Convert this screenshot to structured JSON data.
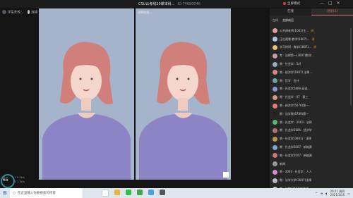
{
  "window": {
    "title": "CSU公考线20课本科...",
    "room_id": "ID:74690046",
    "mode_label": "全屏模式",
    "controls": [
      "—",
      "□",
      "✕"
    ]
  },
  "top_left": {
    "item1": "学生在校...",
    "item2": "连接"
  },
  "videos": [
    {
      "label": ""
    },
    {
      "label": "讲师在线..."
    }
  ],
  "status": {
    "speed_value": "65",
    "upload": "↑ 0.2k/s",
    "download": "↓ 1.3k/s"
  },
  "panel": {
    "tabs": [
      "在线",
      "讨论(1)"
    ],
    "sub_tabs": [
      "在线",
      "全部成员"
    ],
    "members": [
      {
        "name": "公共课老师(1001)主...",
        "color": "#d9a0a0",
        "tag": "讲"
      },
      {
        "name": "正在观看-数学(1807)...",
        "color": "#b0c4de",
        "tag": "讲"
      },
      {
        "name": "学习时间 · 数学(1807)...",
        "color": "#e6c27a",
        "tag": "讲"
      },
      {
        "name": "考 · 法律第一(3007)数学...",
        "color": "#c9a",
        "tag": ""
      },
      {
        "name": "期 · 社会学 · 5/4",
        "color": "#9ab",
        "tag": ""
      },
      {
        "name": "期 · 经济学(1807) 法律...",
        "color": "#d88",
        "tag": ""
      },
      {
        "name": "期 · 哲学 · 会计",
        "color": "#6a9",
        "tag": ""
      },
      {
        "name": "期 · 社会学2806 英语...",
        "color": "#89c",
        "tag": ""
      },
      {
        "name": "期 · 社会学 · 07 · 第三",
        "color": "#c98",
        "tag": ""
      },
      {
        "name": "期 · 经济学(5076)第一 ·",
        "color": "#e77",
        "tag": ""
      },
      {
        "name": "期 · 法学院(6789)第一",
        "color": "#222",
        "tag": ""
      },
      {
        "name": "期 · 社会学 · 2003 · 法律",
        "color": "#5b7",
        "tag": ""
      },
      {
        "name": "期 · 社会学2806 · 经济学",
        "color": "#a77",
        "tag": ""
      },
      {
        "name": "期 · 社会学(3001) · 法律",
        "color": "#b95",
        "tag": ""
      },
      {
        "name": "期 · 社会学2007 · 新能源",
        "color": "#7ac",
        "tag": ""
      },
      {
        "name": "期 · 社会学2007 · 新能源",
        "color": "#c77",
        "tag": ""
      },
      {
        "name": "新闻",
        "color": "#999",
        "tag": ""
      },
      {
        "name": "期 · 2003 · 社会学 · 人人",
        "color": "#d8c",
        "tag": ""
      },
      {
        "name": "期 · 法学大学(3007)法律",
        "color": "#bbb",
        "tag": ""
      },
      {
        "name": "期 · 法院(3007)新能源",
        "color": "#ccc",
        "tag": ""
      }
    ]
  },
  "taskbar": {
    "search_placeholder": "在这里输入你要搜索的内容",
    "apps": [
      {
        "name": "app-1",
        "color": "#ffffff"
      },
      {
        "name": "app-2",
        "color": "#e6b53a"
      },
      {
        "name": "app-3",
        "color": "#2fbf4a"
      },
      {
        "name": "app-4",
        "color": "#3fa34d"
      },
      {
        "name": "app-5",
        "color": "#4aa3df"
      },
      {
        "name": "app-6",
        "color": "#555555"
      }
    ],
    "time": "20:21 周四",
    "date": "2021/3/25"
  }
}
